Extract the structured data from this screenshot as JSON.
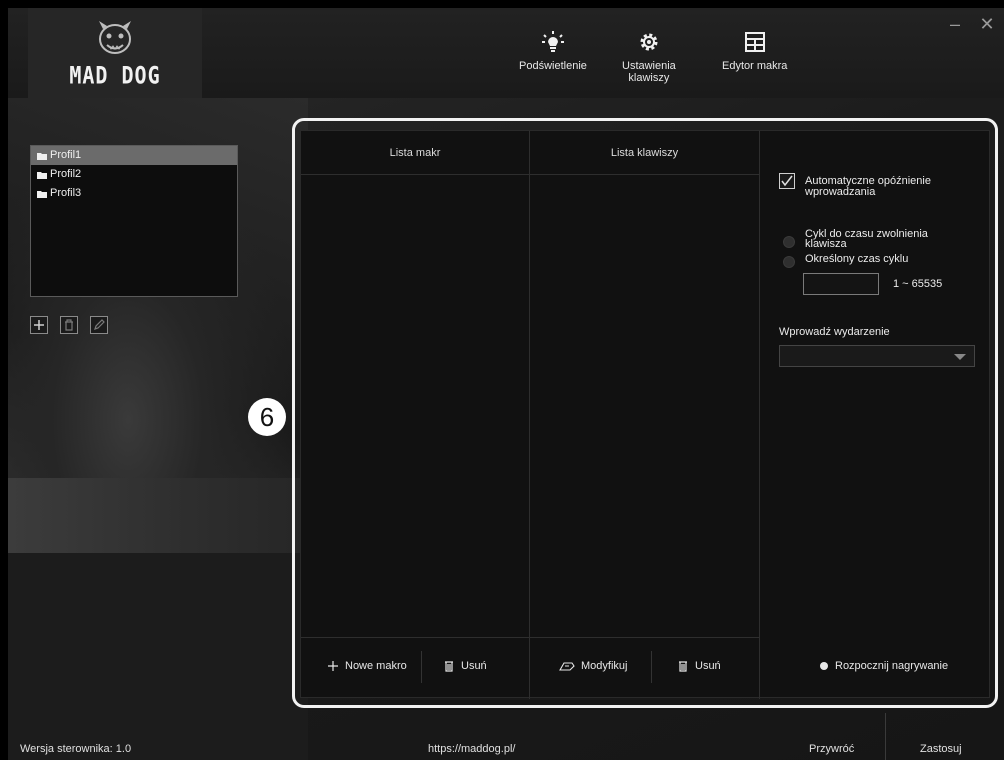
{
  "app": {
    "logo_text": "MAD DOG"
  },
  "nav": [
    {
      "label": "Podświetlenie",
      "icon": "lightbulb-icon"
    },
    {
      "label": "Ustawienia\nklawiszy",
      "line1": "Ustawienia",
      "line2": "klawiszy",
      "icon": "gear-icon"
    },
    {
      "label": "Edytor makra",
      "icon": "grid-icon"
    }
  ],
  "window": {
    "minimize": "–",
    "close": "✕"
  },
  "profiles": [
    "Profil1",
    "Profil2",
    "Profil3"
  ],
  "selected_profile": "Profil1",
  "callout": "6",
  "macro": {
    "macro_list_header": "Lista makr",
    "key_list_header": "Lista klawiszy",
    "auto_delay_line1": "Automatyczne opóźnienie",
    "auto_delay_line2": "wprowadzania",
    "auto_delay_checked": true,
    "cycle_release_line1": "Cykl do czasu zwolnienia",
    "cycle_release_line2": "klawisza",
    "fixed_cycle": "Określony czas cyklu",
    "cycle_range": "1 ~ 65535",
    "cycle_value": "",
    "event_label": "Wprowadź wydarzenie",
    "event_value": "",
    "new_macro": "Nowe makro",
    "delete_macro": "Usuń",
    "modify": "Modyfikuj",
    "delete_key": "Usuń",
    "record": "Rozpocznij nagrywanie"
  },
  "status": {
    "version": "Wersja sterownika: 1.0",
    "url": "https://maddog.pl/",
    "restore": "Przywróć",
    "apply": "Zastosuj"
  }
}
